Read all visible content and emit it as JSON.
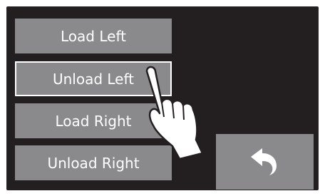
{
  "menu": {
    "items": [
      {
        "label": "Load Left"
      },
      {
        "label": "Unload Left"
      },
      {
        "label": "Load Right"
      },
      {
        "label": "Unload Right"
      }
    ]
  },
  "back_button": {
    "icon": "back-arrow-icon"
  },
  "colors": {
    "screen_bg": "#231f20",
    "button_bg": "#8a8a8c",
    "text": "#ffffff"
  }
}
